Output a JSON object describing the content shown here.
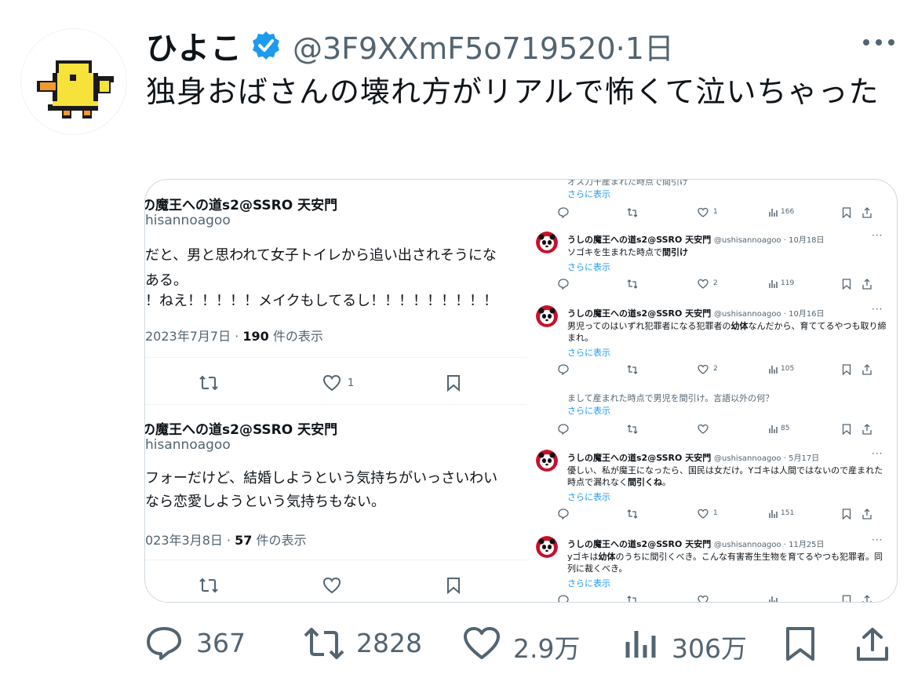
{
  "tweet": {
    "display_name": "ひよこ",
    "handle_time": "@3F9XXmF5o719520·1日",
    "text": "独身おばさんの壊れ方がリアルで怖くて泣いちゃった"
  },
  "media": {
    "left": {
      "tweet1": {
        "name": "の魔王への道s2@SSRO 天安門",
        "handle": "hisannoagoo",
        "line1": "だと、男と思われて女子トイレから追い出されそうにな",
        "line2": "ある。",
        "line3": "！ねえ！！！！！メイクもしてるし！！！！！！！！！",
        "date": "2023年7月7日 · ",
        "views_num": "190",
        "views_label": " 件の表示",
        "like_count": "1"
      },
      "tweet2": {
        "name": "の魔王への道s2@SSRO 天安門",
        "handle": "hisannoagoo",
        "line1": "フォーだけど、結婚しようという気持ちがいっさいわい",
        "line2": "なら恋愛しようという気持ちもない。",
        "date": "023年3月8日 · ",
        "views_num": "57",
        "views_label": " 件の表示"
      }
    },
    "right": {
      "top_cut": "オス力干産まれた時点で間引け",
      "top_more": "さらに表示",
      "top_actions": {
        "like": "1",
        "views": "166"
      },
      "tweets": [
        {
          "name": "うしの魔王への道s2@SSRO 天安門",
          "meta": "@ushisannoagoo · 10月18日",
          "body_pre": "ソゴキを生まれた時点で",
          "body_bold": "間引け",
          "body_post": "",
          "more": "さらに表示",
          "like": "2",
          "views": "119"
        },
        {
          "name": "うしの魔王への道s2@SSRO 天安門",
          "meta": "@ushisannoagoo · 10月16日",
          "body_pre": "男児ってのはいずれ犯罪者になる犯罪者の",
          "body_bold": "幼体",
          "body_post": "なんだから、育ててるやつも取り締まれ。",
          "more": "さらに表示",
          "like": "2",
          "views": "105"
        }
      ],
      "mid_cut": "まして産まれた時点で男児を間引け。言語以外の何？",
      "mid_more": "さらに表示",
      "mid_actions": {
        "like": "",
        "views": "85"
      },
      "tweets2": [
        {
          "name": "うしの魔王への道s2@SSRO 天安門",
          "meta": "@ushisannoagoo · 5月17日",
          "body_pre": "優しい、私が魔王になったら、国民は女だけ。Yゴキは人間ではないので産まれた時点で漏れなく",
          "body_bold": "間引くね",
          "body_post": "。",
          "more": "さらに表示",
          "like": "1",
          "views": "151"
        },
        {
          "name": "うしの魔王への道s2@SSRO 天安門",
          "meta": "@ushisannoagoo · 11月25日",
          "body_pre": "yゴキは",
          "body_bold": "幼体",
          "body_post": "のうちに間引くべき。こんな有害寄生生物を育てるやつも犯罪者。同列に裁くべき。",
          "more": "さらに表示",
          "like": "",
          "views": ""
        }
      ]
    }
  },
  "actions": {
    "replies": "367",
    "reposts": "2828",
    "likes": "2.9万",
    "views": "306万"
  },
  "colors": {
    "accent": "#1d9bf0",
    "muted": "#536471",
    "text": "#0f1419",
    "chick_yellow": "#f7e23a"
  }
}
